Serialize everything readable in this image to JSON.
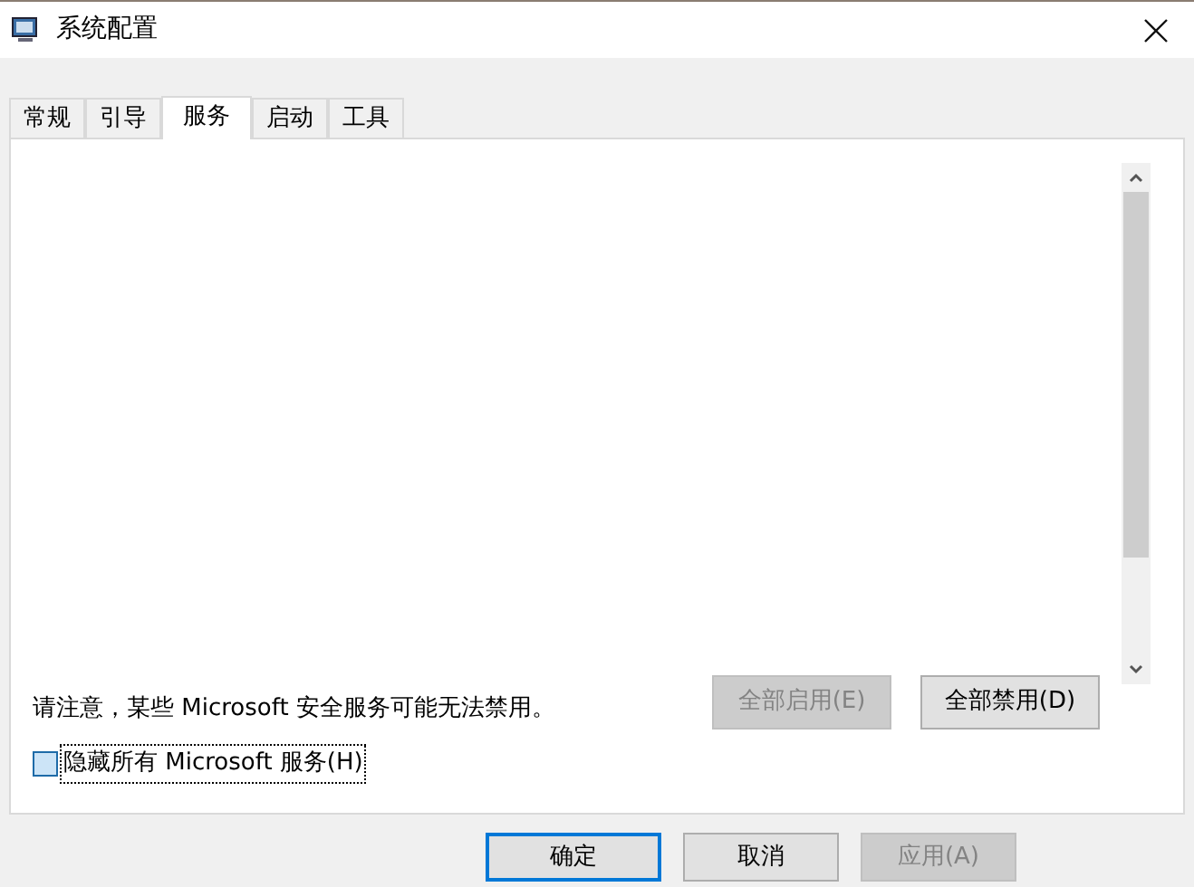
{
  "window": {
    "title": "系统配置"
  },
  "tabs": [
    {
      "label": "常规",
      "selected": false
    },
    {
      "label": "引导",
      "selected": false
    },
    {
      "label": "服务",
      "selected": true
    },
    {
      "label": "启动",
      "selected": false
    },
    {
      "label": "工具",
      "selected": false
    }
  ],
  "note": "请注意，某些 Microsoft 安全服务可能无法禁用。",
  "panel_buttons": [
    {
      "label": "全部启用(E)",
      "disabled": true
    },
    {
      "label": "全部禁用(D)",
      "disabled": false
    }
  ],
  "hide_microsoft": {
    "label": "隐藏所有 Microsoft 服务(H)",
    "checked": false
  },
  "buttons": [
    {
      "label": "确定",
      "disabled": false,
      "default": true
    },
    {
      "label": "取消",
      "disabled": false,
      "default": false
    },
    {
      "label": "应用(A)",
      "disabled": true,
      "default": false
    }
  ]
}
